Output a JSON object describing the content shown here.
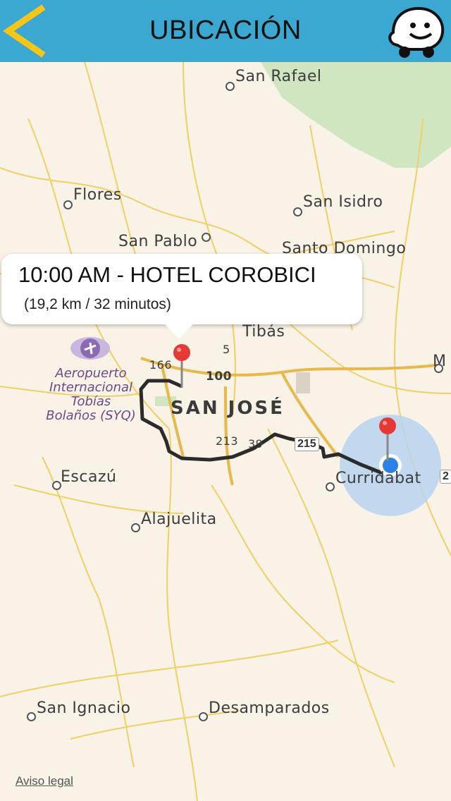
{
  "header": {
    "title": "UBICACIÓN",
    "accent": "#3aa8d0",
    "back_icon": "chevron-left-icon",
    "back_color": "#f5c518",
    "waze_icon": "waze-icon"
  },
  "map": {
    "places": [
      {
        "key": "san_rafael",
        "name": "San Rafael"
      },
      {
        "key": "flores",
        "name": "Flores"
      },
      {
        "key": "san_isidro",
        "name": "San Isidro"
      },
      {
        "key": "san_pablo",
        "name": "San Pablo"
      },
      {
        "key": "santo_domingo",
        "name": "Santo Domingo"
      },
      {
        "key": "tibas",
        "name": "Tibás"
      },
      {
        "key": "escazu",
        "name": "Escazú"
      },
      {
        "key": "alajuelita",
        "name": "Alajuelita"
      },
      {
        "key": "curridabat",
        "name": "Curridabat"
      },
      {
        "key": "san_ignacio",
        "name": "San Ignacio"
      },
      {
        "key": "desamparados",
        "name": "Desamparados"
      }
    ],
    "city": "SAN JOSÉ",
    "airport": [
      "Aeropuerto",
      "Internacional",
      "Tobías",
      "Bolaños (SYQ)"
    ],
    "roads": [
      "166",
      "100",
      "5",
      "213",
      "39",
      "215",
      "2"
    ],
    "edge_label": "M",
    "legal": "Aviso legal"
  },
  "callout": {
    "title": "10:00 AM - HOTEL COROBICI",
    "subtitle": "(19,2 km / 32 minutos)"
  }
}
